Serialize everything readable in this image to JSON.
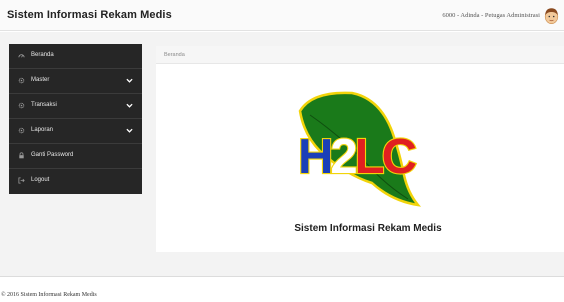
{
  "header": {
    "app_title": "Sistem Informasi Rekam Medis",
    "user_text": "6000 - Adinda - Petugas Administrasi",
    "avatar_icon": "user-avatar-icon"
  },
  "sidebar": {
    "items": [
      {
        "label": "Beranda",
        "icon": "dashboard-icon",
        "has_submenu": false
      },
      {
        "label": "Master",
        "icon": "gear-icon",
        "has_submenu": true
      },
      {
        "label": "Transaksi",
        "icon": "gear-icon",
        "has_submenu": true
      },
      {
        "label": "Laporan",
        "icon": "gear-icon",
        "has_submenu": true
      },
      {
        "label": "Ganti Password",
        "icon": "lock-icon",
        "has_submenu": false
      },
      {
        "label": "Logout",
        "icon": "logout-icon",
        "has_submenu": false
      }
    ]
  },
  "main": {
    "breadcrumb": "Beranda",
    "logo_text": "H2LC",
    "caption": "Sistem Informasi Rekam Medis"
  },
  "footer": {
    "text": "© 2016 Sistem Informasi Rekam Medis"
  },
  "colors": {
    "sidebar_bg": "#262626",
    "logo_leaf": "#1a7a1a",
    "logo_h": "#1a3fb8",
    "logo_lc": "#e02020",
    "logo_outline": "#f2d40a"
  }
}
